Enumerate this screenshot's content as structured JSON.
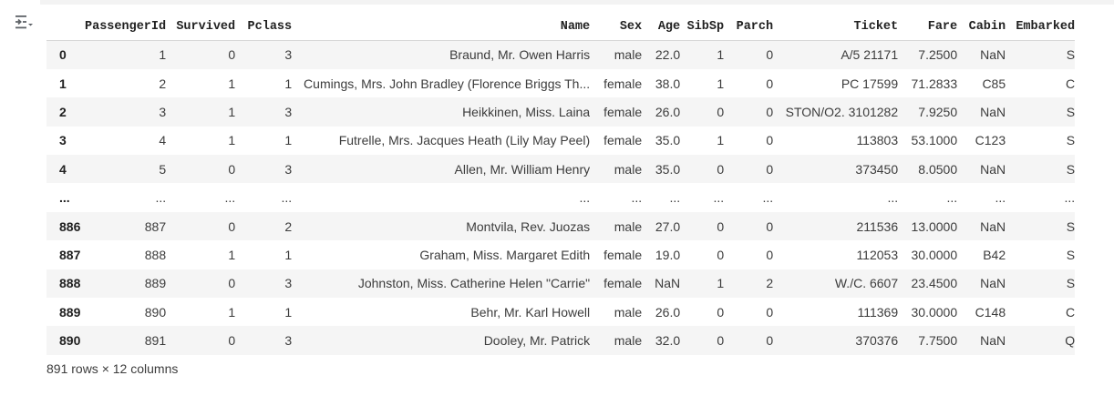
{
  "dataframe": {
    "columns": [
      "",
      "PassengerId",
      "Survived",
      "Pclass",
      "Name",
      "Sex",
      "Age",
      "SibSp",
      "Parch",
      "Ticket",
      "Fare",
      "Cabin",
      "Embarked"
    ],
    "rows": [
      [
        "0",
        "1",
        "0",
        "3",
        "Braund, Mr. Owen Harris",
        "male",
        "22.0",
        "1",
        "0",
        "A/5 21171",
        "7.2500",
        "NaN",
        "S"
      ],
      [
        "1",
        "2",
        "1",
        "1",
        "Cumings, Mrs. John Bradley (Florence Briggs Th...",
        "female",
        "38.0",
        "1",
        "0",
        "PC 17599",
        "71.2833",
        "C85",
        "C"
      ],
      [
        "2",
        "3",
        "1",
        "3",
        "Heikkinen, Miss. Laina",
        "female",
        "26.0",
        "0",
        "0",
        "STON/O2. 3101282",
        "7.9250",
        "NaN",
        "S"
      ],
      [
        "3",
        "4",
        "1",
        "1",
        "Futrelle, Mrs. Jacques Heath (Lily May Peel)",
        "female",
        "35.0",
        "1",
        "0",
        "113803",
        "53.1000",
        "C123",
        "S"
      ],
      [
        "4",
        "5",
        "0",
        "3",
        "Allen, Mr. William Henry",
        "male",
        "35.0",
        "0",
        "0",
        "373450",
        "8.0500",
        "NaN",
        "S"
      ],
      [
        "...",
        "...",
        "...",
        "...",
        "...",
        "...",
        "...",
        "...",
        "...",
        "...",
        "...",
        "...",
        "..."
      ],
      [
        "886",
        "887",
        "0",
        "2",
        "Montvila, Rev. Juozas",
        "male",
        "27.0",
        "0",
        "0",
        "211536",
        "13.0000",
        "NaN",
        "S"
      ],
      [
        "887",
        "888",
        "1",
        "1",
        "Graham, Miss. Margaret Edith",
        "female",
        "19.0",
        "0",
        "0",
        "112053",
        "30.0000",
        "B42",
        "S"
      ],
      [
        "888",
        "889",
        "0",
        "3",
        "Johnston, Miss. Catherine Helen \"Carrie\"",
        "female",
        "NaN",
        "1",
        "2",
        "W./C. 6607",
        "23.4500",
        "NaN",
        "S"
      ],
      [
        "889",
        "890",
        "1",
        "1",
        "Behr, Mr. Karl Howell",
        "male",
        "26.0",
        "0",
        "0",
        "111369",
        "30.0000",
        "C148",
        "C"
      ],
      [
        "890",
        "891",
        "0",
        "3",
        "Dooley, Mr. Patrick",
        "male",
        "32.0",
        "0",
        "0",
        "370376",
        "7.7500",
        "NaN",
        "Q"
      ]
    ],
    "footer": "891 rows × 12 columns"
  },
  "icons": {
    "output_toggle": "output-actions-icon"
  }
}
